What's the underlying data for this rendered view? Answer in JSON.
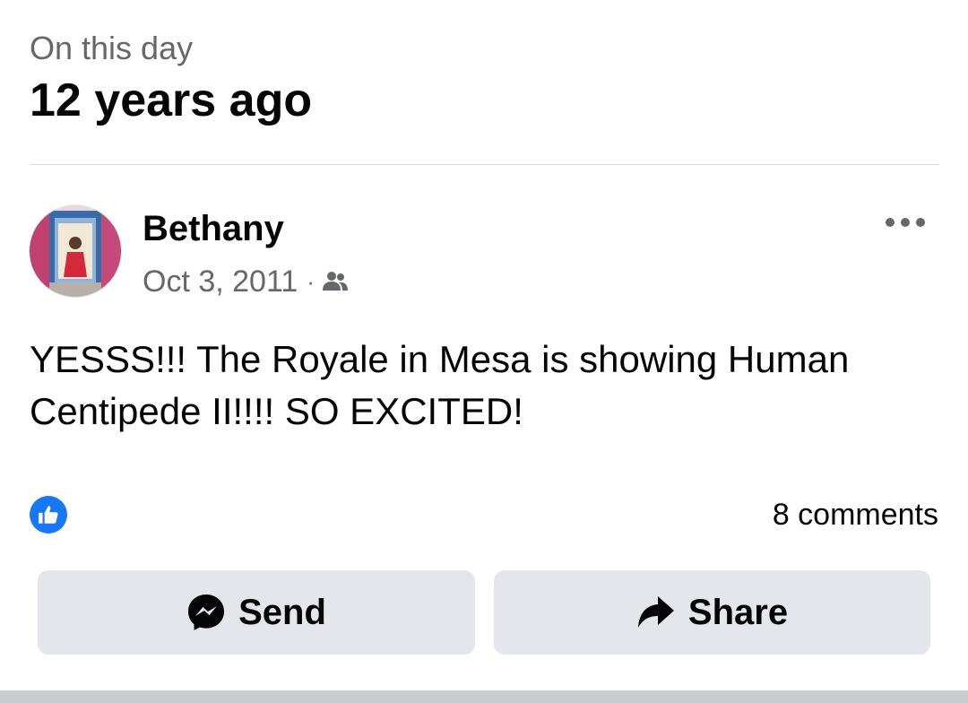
{
  "header": {
    "subtitle": "On this day",
    "title": "12 years ago"
  },
  "post": {
    "author": "Bethany",
    "date": "Oct 3, 2011",
    "separator": "·",
    "audience_icon": "friends-icon",
    "more_icon": "more-options-icon",
    "text": "YESSS!!! The Royale in Mesa is showing Human Centipede II!!!! SO EXCITED!",
    "reaction_icon": "like-icon",
    "comments_label": "8 comments"
  },
  "actions": {
    "send_label": "Send",
    "send_icon": "messenger-icon",
    "share_label": "Share",
    "share_icon": "share-arrow-icon"
  },
  "colors": {
    "accent": "#1877f2",
    "button_bg": "#e4e6eb",
    "secondary_text": "#65676b",
    "primary_text": "#050505"
  }
}
